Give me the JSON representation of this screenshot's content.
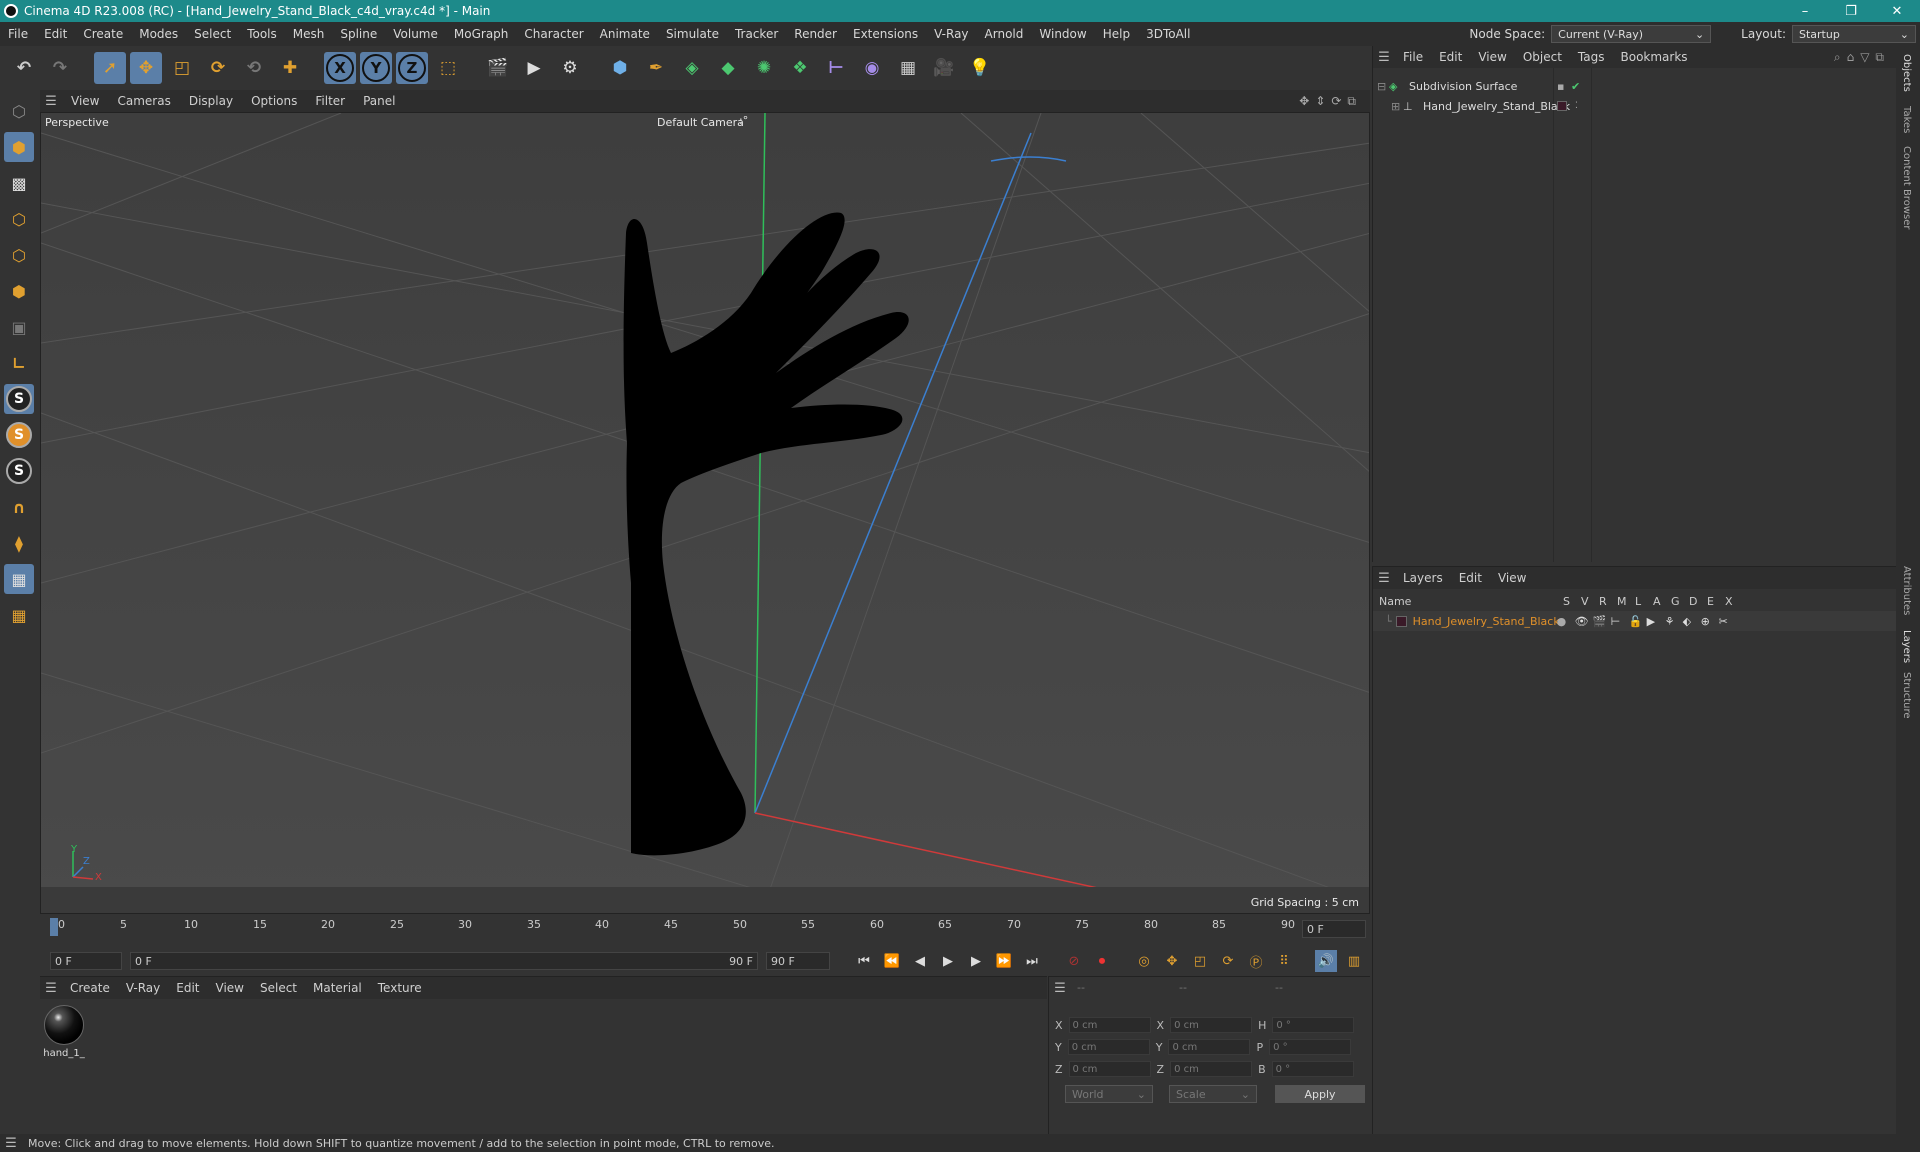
{
  "window": {
    "title": "Cinema 4D R23.008 (RC) - [Hand_Jewelry_Stand_Black_c4d_vray.c4d *] - Main",
    "minimize": "–",
    "maximize": "❐",
    "close": "✕"
  },
  "menubar": {
    "items": [
      "File",
      "Edit",
      "Create",
      "Modes",
      "Select",
      "Tools",
      "Mesh",
      "Spline",
      "Volume",
      "MoGraph",
      "Character",
      "Animate",
      "Simulate",
      "Tracker",
      "Render",
      "Extensions",
      "V-Ray",
      "Arnold",
      "Window",
      "Help",
      "3DToAll"
    ],
    "node_space_label": "Node Space:",
    "node_space_value": "Current (V-Ray)",
    "layout_label": "Layout:",
    "layout_value": "Startup"
  },
  "toolbar": {
    "axis_x": "X",
    "axis_y": "Y",
    "axis_z": "Z"
  },
  "viewport": {
    "menu": [
      "View",
      "Cameras",
      "Display",
      "Options",
      "Filter",
      "Panel"
    ],
    "view_name": "Perspective",
    "camera": "Default Camera",
    "camera_suffix": ":°",
    "grid_spacing": "Grid Spacing : 5 cm",
    "axis_y": "Y",
    "axis_z": "Z",
    "axis_x": "X"
  },
  "timeline": {
    "ticks": [
      "0",
      "5",
      "10",
      "15",
      "20",
      "25",
      "30",
      "35",
      "40",
      "45",
      "50",
      "55",
      "60",
      "65",
      "70",
      "75",
      "80",
      "85",
      "90"
    ],
    "current_frame": "0 F",
    "start": "0 F",
    "range_start": "0 F",
    "range_end": "90 F",
    "end": "90 F"
  },
  "materials": {
    "menu": [
      "Create",
      "V-Ray",
      "Edit",
      "View",
      "Select",
      "Material",
      "Texture"
    ],
    "items": [
      {
        "name": "hand_1_"
      }
    ]
  },
  "coordinates": {
    "headers": [
      "--",
      "--",
      "--"
    ],
    "rows": [
      {
        "a": "X",
        "av": "0 cm",
        "b": "X",
        "bv": "0 cm",
        "c": "H",
        "cv": "0 °"
      },
      {
        "a": "Y",
        "av": "0 cm",
        "b": "Y",
        "bv": "0 cm",
        "c": "P",
        "cv": "0 °"
      },
      {
        "a": "Z",
        "av": "0 cm",
        "b": "Z",
        "bv": "0 cm",
        "c": "B",
        "cv": "0 °"
      }
    ],
    "mode1": "World",
    "mode2": "Scale",
    "apply": "Apply"
  },
  "objects": {
    "menu": [
      "File",
      "Edit",
      "View",
      "Object",
      "Tags",
      "Bookmarks"
    ],
    "items": [
      {
        "name": "Subdivision Surface"
      },
      {
        "name": "Hand_Jewelry_Stand_Black"
      }
    ]
  },
  "layers": {
    "menu": [
      "Layers",
      "Edit",
      "View"
    ],
    "columns": [
      "Name",
      "S",
      "V",
      "R",
      "M",
      "L",
      "A",
      "G",
      "D",
      "E",
      "X"
    ],
    "items": [
      {
        "name": "Hand_Jewelry_Stand_Black",
        "color": "#3a1a28"
      }
    ]
  },
  "sidetabs": [
    "Objects",
    "Takes",
    "Content Browser",
    "Attributes",
    "Layers",
    "Structure"
  ],
  "status": "Move: Click and drag to move elements. Hold down SHIFT to quantize movement / add to the selection in point mode, CTRL to remove.",
  "colors": {
    "titlebar": "#1d8a8a",
    "accent": "#5b7fa8",
    "layer_name": "#e0902a"
  }
}
